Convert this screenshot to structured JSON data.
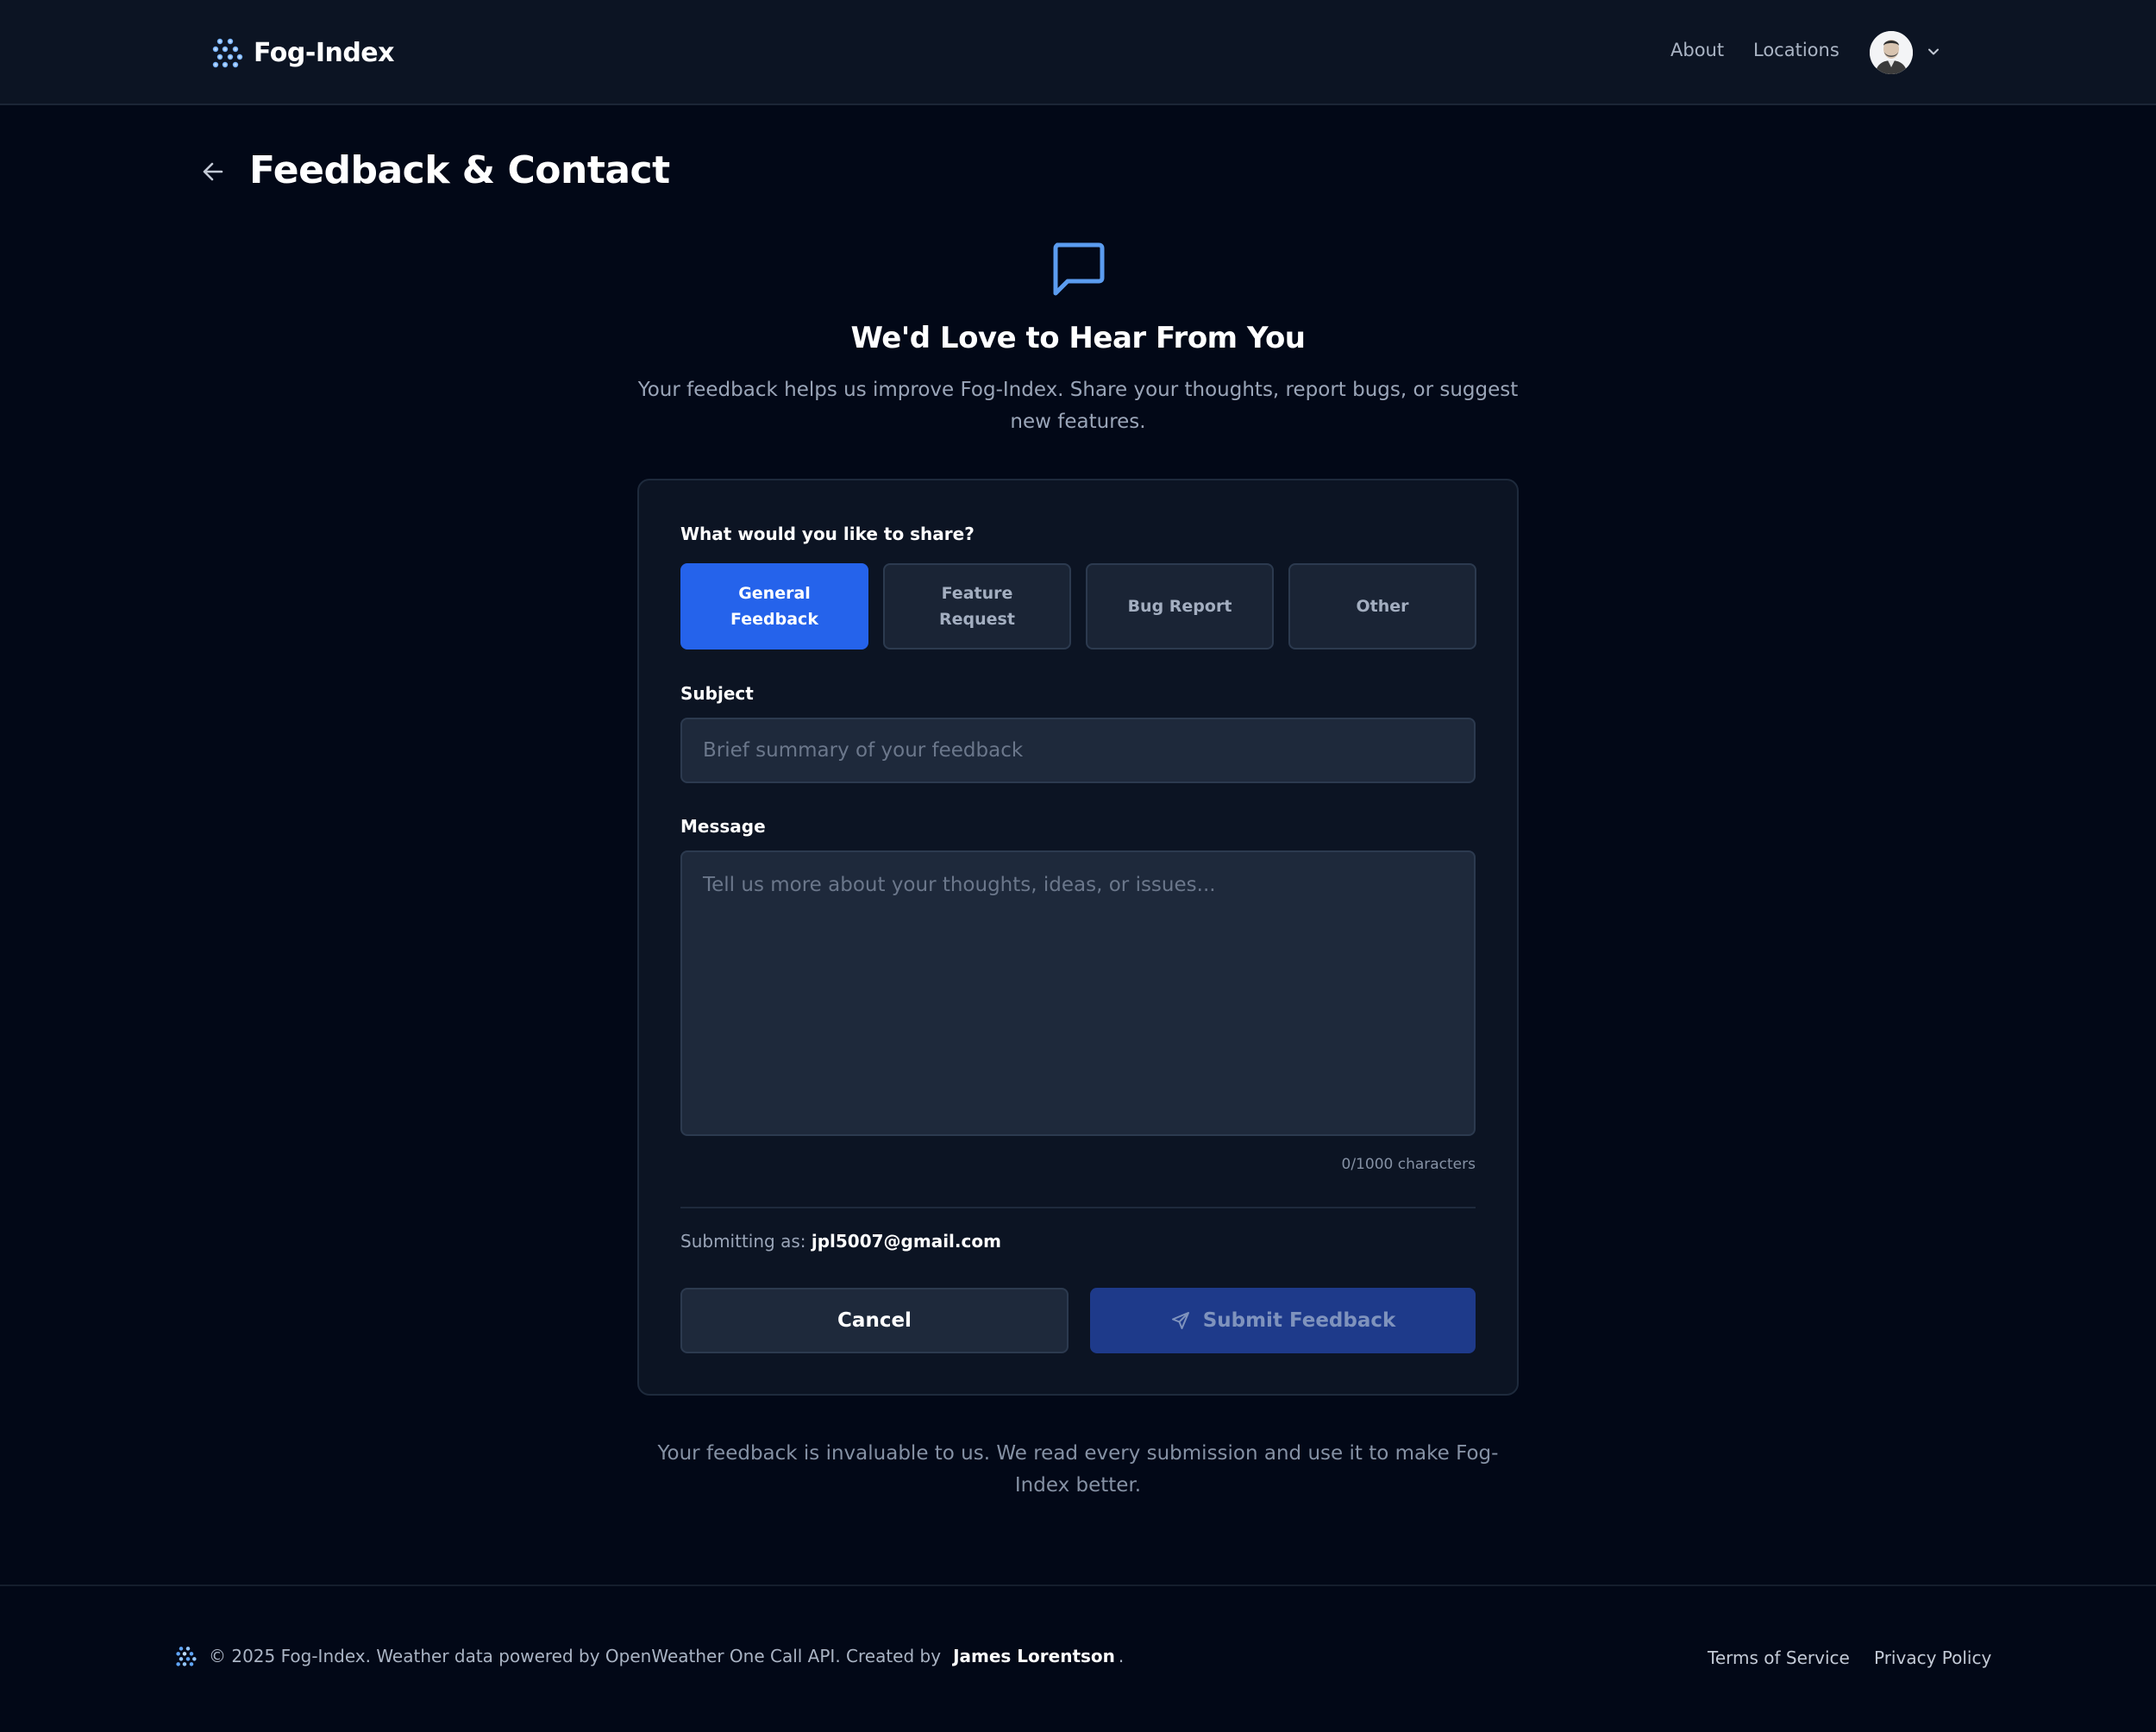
{
  "colors": {
    "background": "#020817",
    "navbar": "#0c1423",
    "card": "#0c1423",
    "accent": "#2563eb",
    "accent_muted": "#1e3a8a",
    "icon_blue": "#5b9cf0"
  },
  "icons": {
    "logo": "dot-grid-logo-icon",
    "back": "arrow-left-icon",
    "hero": "message-square-icon",
    "dropdown": "chevron-down-icon",
    "submit": "send-icon"
  },
  "header": {
    "brand": "Fog-Index",
    "nav": {
      "about": "About",
      "locations": "Locations"
    }
  },
  "page": {
    "title": "Feedback & Contact"
  },
  "hero": {
    "title": "We'd Love to Hear From You",
    "subtitle": "Your feedback helps us improve Fog-Index. Share your thoughts, report bugs, or suggest new features."
  },
  "form": {
    "type_label": "What would you like to share?",
    "types": [
      "General Feedback",
      "Feature Request",
      "Bug Report",
      "Other"
    ],
    "selected_type": "General Feedback",
    "subject_label": "Subject",
    "subject_placeholder": "Brief summary of your feedback",
    "subject_value": "",
    "message_label": "Message",
    "message_placeholder": "Tell us more about your thoughts, ideas, or issues...",
    "message_value": "",
    "char_count": "0/1000 characters",
    "submitting_prefix": "Submitting as:",
    "submitting_email": "jpl5007@gmail.com",
    "cancel_label": "Cancel",
    "submit_label": "Submit Feedback"
  },
  "note": "Your feedback is invaluable to us. We read every submission and use it to make Fog-Index better.",
  "footer": {
    "copyright": "© 2025 Fog-Index. Weather data powered by OpenWeather One Call API. Created by",
    "author": "James Lorentson",
    "period": ".",
    "terms": "Terms of Service",
    "privacy": "Privacy Policy"
  }
}
